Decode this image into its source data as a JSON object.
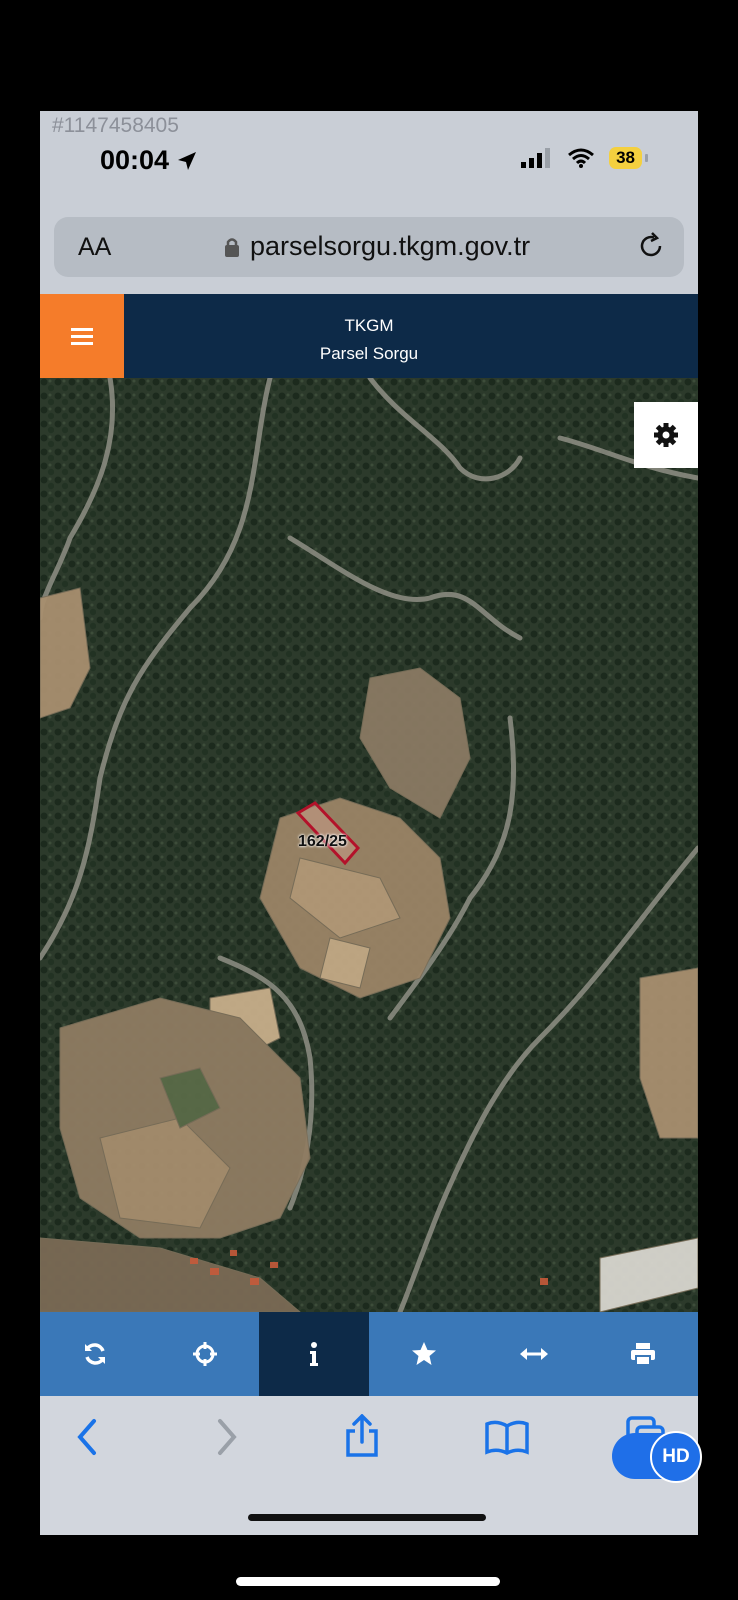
{
  "watermark": "#1147458405",
  "status": {
    "time": "00:04",
    "battery": "38"
  },
  "browser": {
    "text_size_label": "AA",
    "url": "parselsorgu.tkgm.gov.tr"
  },
  "header": {
    "title": "TKGM",
    "subtitle": "Parsel Sorgu"
  },
  "map": {
    "parcel_label": "162/25",
    "parcel_outline_color": "#b3122a"
  },
  "toolbar": {
    "items": [
      {
        "icon": "refresh-icon"
      },
      {
        "icon": "locate-icon"
      },
      {
        "icon": "info-icon",
        "active": true
      },
      {
        "icon": "star-icon"
      },
      {
        "icon": "measure-icon"
      },
      {
        "icon": "print-icon"
      }
    ]
  },
  "safari_nav": [
    "back-icon",
    "forward-icon",
    "share-icon",
    "bookmarks-icon",
    "tabs-icon"
  ],
  "hd_badge": "HD",
  "colors": {
    "header": "#0d2a48",
    "menu": "#f57c2a",
    "toolbar": "#3a78b8",
    "hd": "#1f6fe8"
  }
}
